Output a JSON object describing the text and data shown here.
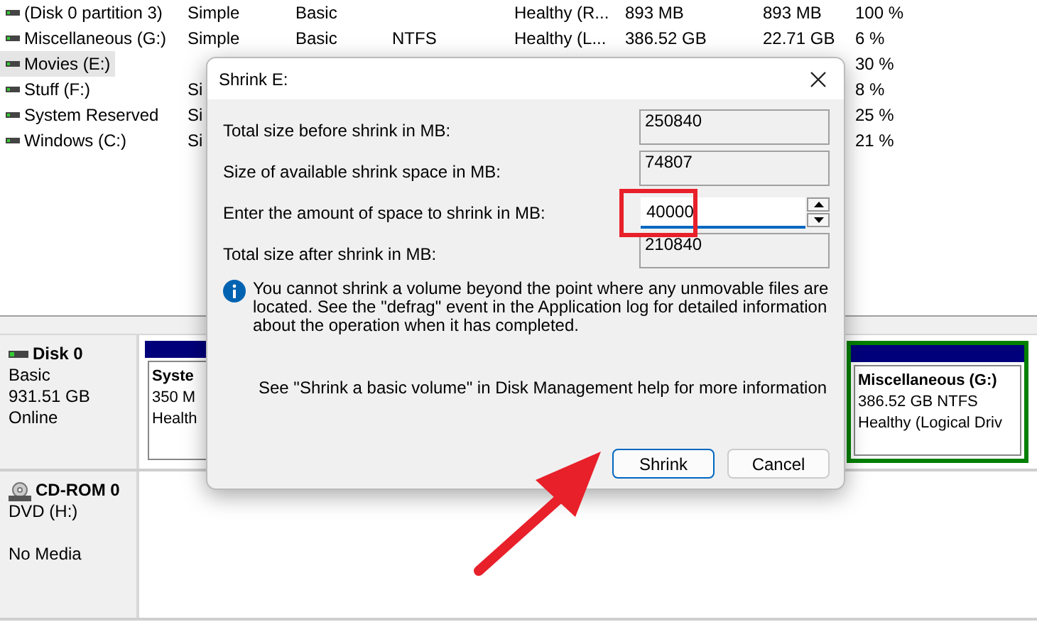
{
  "volumes": [
    {
      "column_1": "(Disk 0 partition 3)",
      "column_2": "Simple",
      "column_3": "Basic",
      "column_5": "Healthy (R...",
      "column_6": "893 MB",
      "column_7": "893 MB",
      "column_8": "100 %",
      "selected": false
    },
    {
      "column_1": "Miscellaneous (G:)",
      "column_2": "Simple",
      "column_3": "Basic",
      "column_4": "NTFS",
      "column_5": "Healthy (L...",
      "column_6": "386.52 GB",
      "column_7": "22.71 GB",
      "column_8": "6 %",
      "selected": false
    },
    {
      "column_1": "Movies (E:)",
      "column_8": "30 %",
      "selected": true
    },
    {
      "column_1": "Stuff (F:)",
      "column_2": "Si",
      "column_8": "8 %",
      "selected": false
    },
    {
      "column_1": "System Reserved",
      "column_2": "Si",
      "column_8": "25 %",
      "selected": false
    },
    {
      "column_1": "Windows (C:)",
      "column_2": "Si",
      "column_8": "21 %",
      "selected": false
    }
  ],
  "disks": [
    {
      "kind": "disk",
      "name": "Disk 0",
      "lines": [
        "Basic",
        "931.51 GB",
        "Online"
      ],
      "partitions": [
        {
          "kind": "primary",
          "name": "Syste",
          "size": "350 M",
          "status": "Health"
        },
        {
          "kind": "logical",
          "name": "Miscellaneous  (G:)",
          "size": "386.52 GB NTFS",
          "status": "Healthy (Logical Driv"
        }
      ]
    },
    {
      "kind": "cdrom",
      "name": "CD-ROM 0",
      "lines": [
        "DVD (H:)",
        "No Media"
      ]
    }
  ],
  "dialog": {
    "title": "Shrink E:",
    "fields": [
      {
        "kind": "readonly",
        "label": "Total size before shrink in MB:",
        "value": "250840"
      },
      {
        "kind": "readonly",
        "label": "Size of available shrink space in MB:",
        "value": "74807"
      },
      {
        "kind": "spin",
        "label": "Enter the amount of space to shrink in MB:",
        "value": "40000",
        "highlighted": true
      },
      {
        "kind": "readonly",
        "label": "Total size after shrink in MB:",
        "value": "210840"
      }
    ],
    "info": "You cannot shrink a volume beyond the point where any unmovable files are located. See the \"defrag\" event in the Application log for detailed information about the operation when it has completed.",
    "help": "See \"Shrink a basic volume\" in Disk Management help for more information",
    "buttons": [
      {
        "label": "Shrink",
        "default": true
      },
      {
        "label": "Cancel",
        "default": false
      }
    ]
  }
}
